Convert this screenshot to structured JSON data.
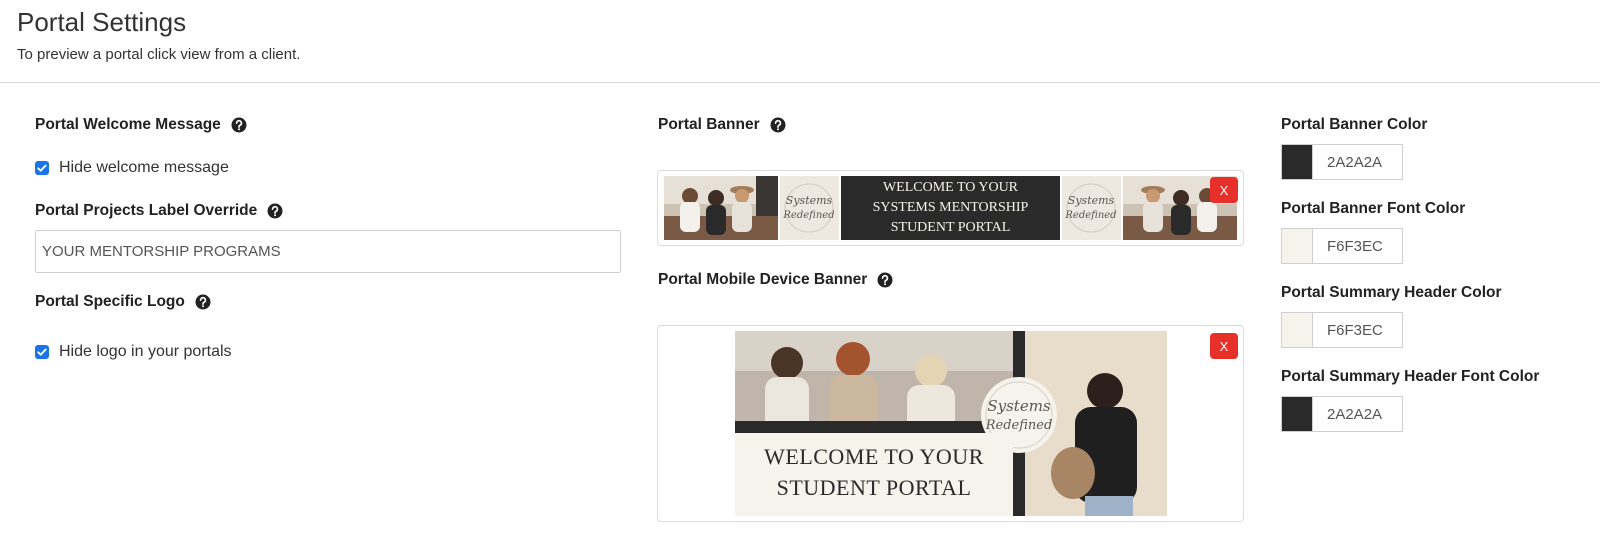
{
  "header": {
    "title": "Portal Settings",
    "subtitle": "To preview a portal click view from a client."
  },
  "welcome": {
    "label": "Portal Welcome Message",
    "hide_label": "Hide welcome message",
    "hide_checked": true
  },
  "projects": {
    "label": "Portal Projects Label Override",
    "value": "YOUR MENTORSHIP PROGRAMS"
  },
  "logo": {
    "label": "Portal Specific Logo",
    "hide_label": "Hide logo in your portals",
    "hide_checked": true
  },
  "banner": {
    "label": "Portal Banner",
    "remove_label": "X",
    "text_line1": "WELCOME TO YOUR",
    "text_line2": "SYSTEMS MENTORSHIP",
    "text_line3": "STUDENT PORTAL",
    "logo_line1": "Systems",
    "logo_line2": "Redefined"
  },
  "mobile_banner": {
    "label": "Portal Mobile Device Banner",
    "remove_label": "X",
    "text_line1": "WELCOME TO YOUR",
    "text_line2": "STUDENT PORTAL",
    "logo_line1": "Systems",
    "logo_line2": "Redefined"
  },
  "colors": [
    {
      "label": "Portal Banner Color",
      "hex": "2A2A2A",
      "swatch": "#2a2a2a"
    },
    {
      "label": "Portal Banner Font Color",
      "hex": "F6F3EC",
      "swatch": "#f6f3ec"
    },
    {
      "label": "Portal Summary Header Color",
      "hex": "F6F3EC",
      "swatch": "#f6f3ec"
    },
    {
      "label": "Portal Summary Header Font Color",
      "hex": "2A2A2A",
      "swatch": "#2a2a2a"
    }
  ],
  "icons": {
    "help": "question-circle-icon",
    "check": "checkmark-icon"
  }
}
